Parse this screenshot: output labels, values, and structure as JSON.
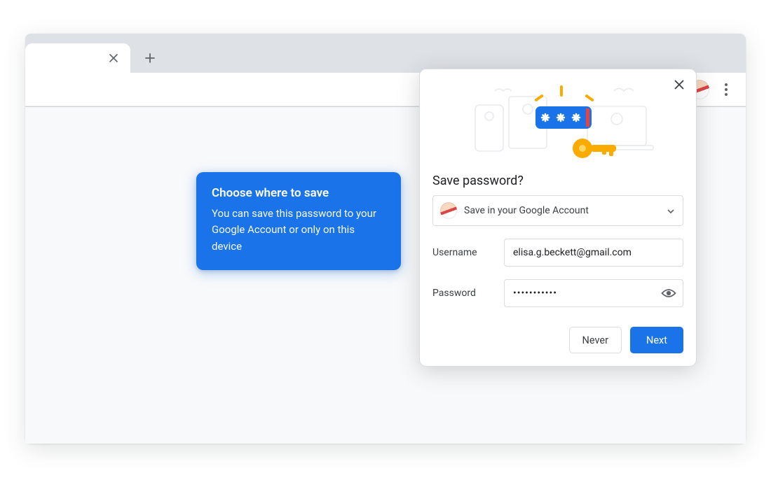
{
  "tooltip": {
    "title": "Choose where to save",
    "body": "You can save this password to your Google Account or only on this device"
  },
  "popup": {
    "title": "Save password?",
    "accountSelect": {
      "label": "Save in your Google Account"
    },
    "fields": {
      "usernameLabel": "Username",
      "usernameValue": "elisa.g.beckett@gmail.com",
      "passwordLabel": "Password",
      "passwordValue": "•••••••••••"
    },
    "buttons": {
      "never": "Never",
      "next": "Next"
    }
  },
  "colors": {
    "accent": "#1a73e8",
    "key": "#f9ab00"
  }
}
